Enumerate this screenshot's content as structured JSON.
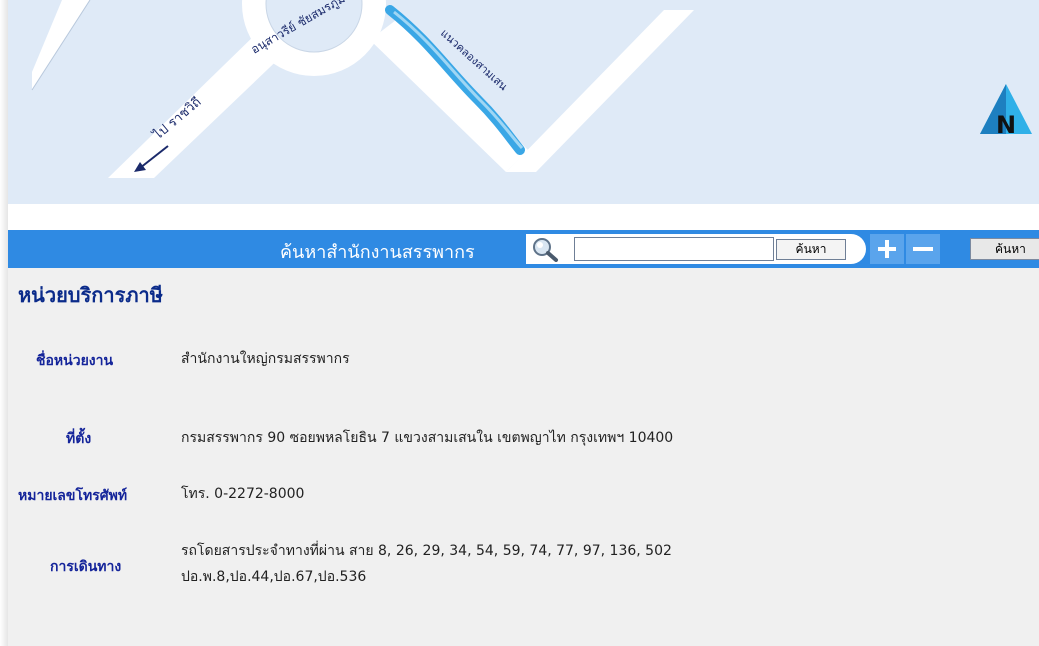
{
  "map": {
    "road_label_monument": "อนุสาวรีย์ ชัยสมรภูมิ",
    "canal_label": "แนวคลองสามเสน",
    "road_label_rajawithi": "ไป ราชวิถี",
    "north_label": "N"
  },
  "search_bar": {
    "title": "ค้นหาสำนักงานสรรพากร",
    "input_value": "",
    "search_label": "ค้นหา",
    "zoom_in": "+",
    "zoom_out": "−",
    "search2_label": "ค้นหา"
  },
  "heading": "หน่วยบริการภาษี",
  "details": {
    "name_label": "ชื่อหน่วยงาน",
    "name_value": "สำนักงานใหญ่กรมสรรพากร",
    "location_label": "ที่ตั้ง",
    "location_value": "กรมสรรพากร 90 ซอยพหลโยธิน 7 แขวงสามเสนใน เขตพญาไท กรุงเทพฯ 10400",
    "phone_label": "หมายเลขโทรศัพท์",
    "phone_value": "โทร. 0-2272-8000",
    "travel_label": "การเดินทาง",
    "travel_line1": "รถโดยสารประจำทางที่ผ่าน สาย 8, 26, 29, 34, 54, 59, 74, 77, 97, 136, 502",
    "travel_line2": "ปอ.พ.8,ปอ.44,ปอ.67,ปอ.536"
  },
  "colors": {
    "bar": "#2f8ae3",
    "heading": "#0b2b8a",
    "map_bg": "#dfeaf7"
  }
}
